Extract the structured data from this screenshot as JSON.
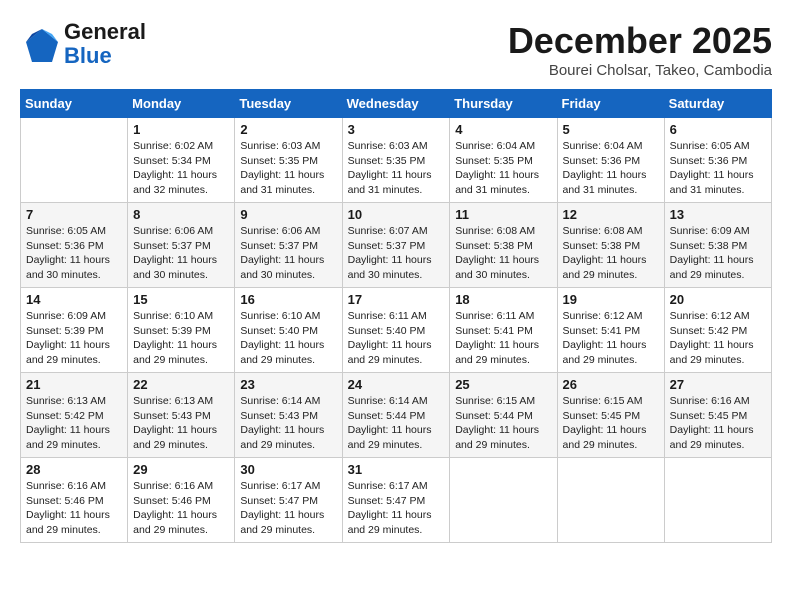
{
  "logo": {
    "line1": "General",
    "line2": "Blue"
  },
  "title": "December 2025",
  "location": "Bourei Cholsar, Takeo, Cambodia",
  "weekdays": [
    "Sunday",
    "Monday",
    "Tuesday",
    "Wednesday",
    "Thursday",
    "Friday",
    "Saturday"
  ],
  "weeks": [
    [
      {
        "day": "",
        "info": ""
      },
      {
        "day": "1",
        "info": "Sunrise: 6:02 AM\nSunset: 5:34 PM\nDaylight: 11 hours\nand 32 minutes."
      },
      {
        "day": "2",
        "info": "Sunrise: 6:03 AM\nSunset: 5:35 PM\nDaylight: 11 hours\nand 31 minutes."
      },
      {
        "day": "3",
        "info": "Sunrise: 6:03 AM\nSunset: 5:35 PM\nDaylight: 11 hours\nand 31 minutes."
      },
      {
        "day": "4",
        "info": "Sunrise: 6:04 AM\nSunset: 5:35 PM\nDaylight: 11 hours\nand 31 minutes."
      },
      {
        "day": "5",
        "info": "Sunrise: 6:04 AM\nSunset: 5:36 PM\nDaylight: 11 hours\nand 31 minutes."
      },
      {
        "day": "6",
        "info": "Sunrise: 6:05 AM\nSunset: 5:36 PM\nDaylight: 11 hours\nand 31 minutes."
      }
    ],
    [
      {
        "day": "7",
        "info": "Sunrise: 6:05 AM\nSunset: 5:36 PM\nDaylight: 11 hours\nand 30 minutes."
      },
      {
        "day": "8",
        "info": "Sunrise: 6:06 AM\nSunset: 5:37 PM\nDaylight: 11 hours\nand 30 minutes."
      },
      {
        "day": "9",
        "info": "Sunrise: 6:06 AM\nSunset: 5:37 PM\nDaylight: 11 hours\nand 30 minutes."
      },
      {
        "day": "10",
        "info": "Sunrise: 6:07 AM\nSunset: 5:37 PM\nDaylight: 11 hours\nand 30 minutes."
      },
      {
        "day": "11",
        "info": "Sunrise: 6:08 AM\nSunset: 5:38 PM\nDaylight: 11 hours\nand 30 minutes."
      },
      {
        "day": "12",
        "info": "Sunrise: 6:08 AM\nSunset: 5:38 PM\nDaylight: 11 hours\nand 29 minutes."
      },
      {
        "day": "13",
        "info": "Sunrise: 6:09 AM\nSunset: 5:38 PM\nDaylight: 11 hours\nand 29 minutes."
      }
    ],
    [
      {
        "day": "14",
        "info": "Sunrise: 6:09 AM\nSunset: 5:39 PM\nDaylight: 11 hours\nand 29 minutes."
      },
      {
        "day": "15",
        "info": "Sunrise: 6:10 AM\nSunset: 5:39 PM\nDaylight: 11 hours\nand 29 minutes."
      },
      {
        "day": "16",
        "info": "Sunrise: 6:10 AM\nSunset: 5:40 PM\nDaylight: 11 hours\nand 29 minutes."
      },
      {
        "day": "17",
        "info": "Sunrise: 6:11 AM\nSunset: 5:40 PM\nDaylight: 11 hours\nand 29 minutes."
      },
      {
        "day": "18",
        "info": "Sunrise: 6:11 AM\nSunset: 5:41 PM\nDaylight: 11 hours\nand 29 minutes."
      },
      {
        "day": "19",
        "info": "Sunrise: 6:12 AM\nSunset: 5:41 PM\nDaylight: 11 hours\nand 29 minutes."
      },
      {
        "day": "20",
        "info": "Sunrise: 6:12 AM\nSunset: 5:42 PM\nDaylight: 11 hours\nand 29 minutes."
      }
    ],
    [
      {
        "day": "21",
        "info": "Sunrise: 6:13 AM\nSunset: 5:42 PM\nDaylight: 11 hours\nand 29 minutes."
      },
      {
        "day": "22",
        "info": "Sunrise: 6:13 AM\nSunset: 5:43 PM\nDaylight: 11 hours\nand 29 minutes."
      },
      {
        "day": "23",
        "info": "Sunrise: 6:14 AM\nSunset: 5:43 PM\nDaylight: 11 hours\nand 29 minutes."
      },
      {
        "day": "24",
        "info": "Sunrise: 6:14 AM\nSunset: 5:44 PM\nDaylight: 11 hours\nand 29 minutes."
      },
      {
        "day": "25",
        "info": "Sunrise: 6:15 AM\nSunset: 5:44 PM\nDaylight: 11 hours\nand 29 minutes."
      },
      {
        "day": "26",
        "info": "Sunrise: 6:15 AM\nSunset: 5:45 PM\nDaylight: 11 hours\nand 29 minutes."
      },
      {
        "day": "27",
        "info": "Sunrise: 6:16 AM\nSunset: 5:45 PM\nDaylight: 11 hours\nand 29 minutes."
      }
    ],
    [
      {
        "day": "28",
        "info": "Sunrise: 6:16 AM\nSunset: 5:46 PM\nDaylight: 11 hours\nand 29 minutes."
      },
      {
        "day": "29",
        "info": "Sunrise: 6:16 AM\nSunset: 5:46 PM\nDaylight: 11 hours\nand 29 minutes."
      },
      {
        "day": "30",
        "info": "Sunrise: 6:17 AM\nSunset: 5:47 PM\nDaylight: 11 hours\nand 29 minutes."
      },
      {
        "day": "31",
        "info": "Sunrise: 6:17 AM\nSunset: 5:47 PM\nDaylight: 11 hours\nand 29 minutes."
      },
      {
        "day": "",
        "info": ""
      },
      {
        "day": "",
        "info": ""
      },
      {
        "day": "",
        "info": ""
      }
    ]
  ]
}
